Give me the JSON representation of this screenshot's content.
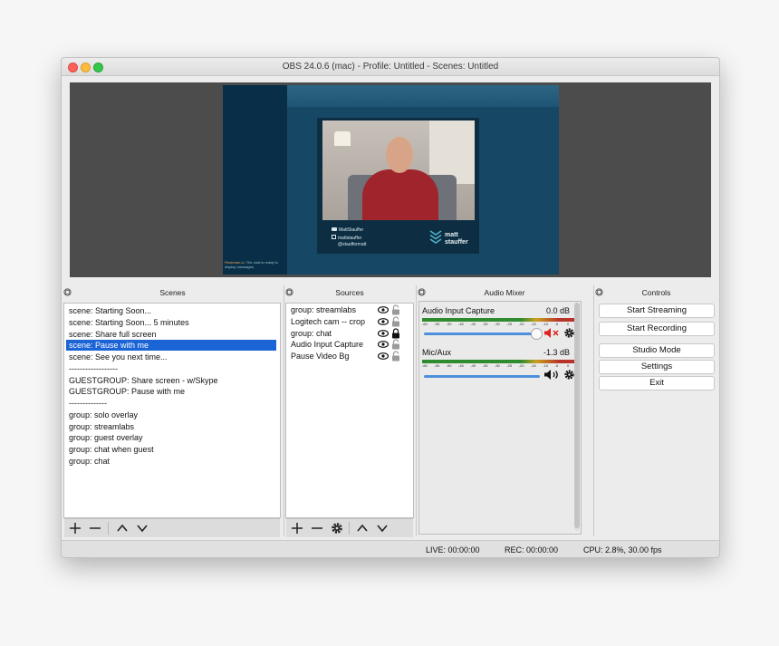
{
  "window": {
    "title": "OBS 24.0.6 (mac) - Profile: Untitled - Scenes: Untitled"
  },
  "preview": {
    "chat_message": "Restream.io: The chat is ready to display messages.",
    "chat_prefix": "Restream.io:",
    "chat_rest": "The chat is ready to display messages.",
    "social": [
      "MattStauffer",
      "mattstauffer",
      "@stauffermatt"
    ],
    "brand_line1": "matt",
    "brand_line2": "stauffer"
  },
  "scenes": {
    "title": "Scenes",
    "items": [
      "scene: Starting Soon...",
      "scene: Starting Soon... 5 minutes",
      "scene: Share full screen",
      "scene: Pause with me",
      "scene: See you next time...",
      "------------------",
      "GUESTGROUP: Share screen - w/Skype",
      "GUESTGROUP: Pause with me",
      "--------------",
      "group: solo overlay",
      "group: streamlabs",
      "group: guest overlay",
      "group: chat when guest",
      "group: chat"
    ],
    "selected_index": 3
  },
  "sources": {
    "title": "Sources",
    "items": [
      {
        "label": "group: streamlabs",
        "locked": false
      },
      {
        "label": "Logitech cam -- crop",
        "locked": false
      },
      {
        "label": "group: chat",
        "locked": true
      },
      {
        "label": "Audio Input Capture",
        "locked": false
      },
      {
        "label": "Pause Video Bg",
        "locked": false
      }
    ]
  },
  "mixer": {
    "title": "Audio Mixer",
    "tick_labels": [
      "-60",
      "-55",
      "-50",
      "-45",
      "-40",
      "-35",
      "-30",
      "-25",
      "-20",
      "-15",
      "-10",
      "-5",
      "0"
    ],
    "channels": [
      {
        "name": "Audio Input Capture",
        "db": "0.0 dB",
        "muted": true,
        "volume": 1.0
      },
      {
        "name": "Mic/Aux",
        "db": "-1.3 dB",
        "muted": false,
        "volume": 0.94
      }
    ]
  },
  "controls": {
    "title": "Controls",
    "start_streaming": "Start Streaming",
    "start_recording": "Start Recording",
    "studio_mode": "Studio Mode",
    "settings": "Settings",
    "exit": "Exit"
  },
  "status": {
    "live": "LIVE: 00:00:00",
    "rec": "REC: 00:00:00",
    "cpu": "CPU: 2.8%, 30.00 fps"
  },
  "colors": {
    "selection": "#1b64d6",
    "accent_blue": "#4d8fdc",
    "mute_red": "#e02020",
    "traffic_red": "#fc605b",
    "traffic_yellow": "#fdbc40",
    "traffic_green": "#34c84a"
  }
}
